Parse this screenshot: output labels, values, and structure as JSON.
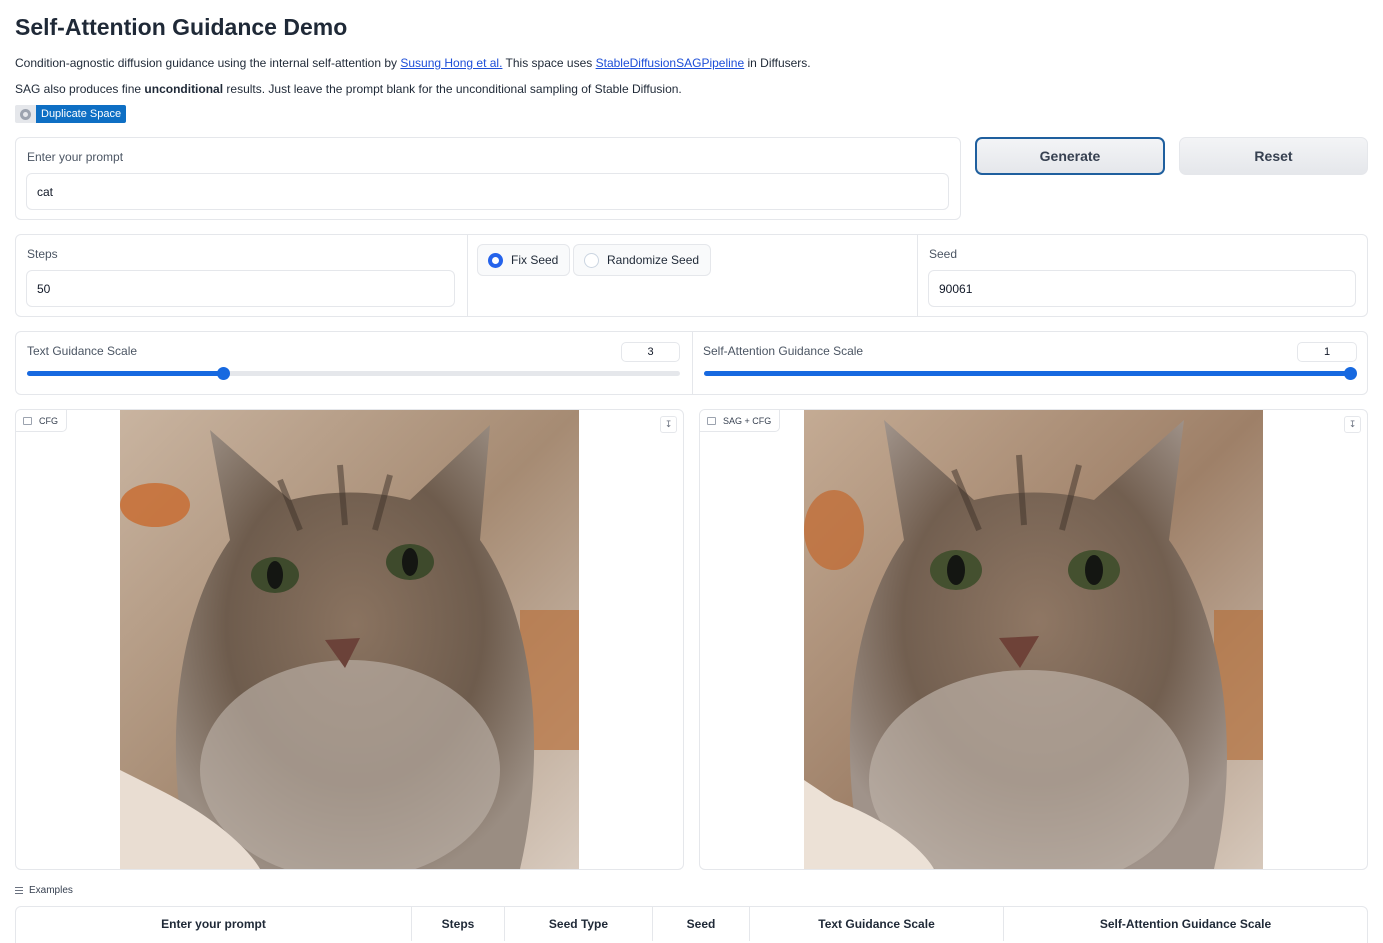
{
  "page": {
    "title": "Self-Attention Guidance Demo",
    "desc1_a": "Condition-agnostic diffusion guidance using the internal self-attention by ",
    "desc1_link1": "Susung Hong et al.",
    "desc1_b": " This space uses ",
    "desc1_link2": "StableDiffusionSAGPipeline",
    "desc1_c": " in Diffusers.",
    "desc2_a": "SAG also produces fine ",
    "desc2_bold": "unconditional",
    "desc2_b": " results. Just leave the prompt blank for the unconditional sampling of Stable Diffusion.",
    "duplicate_label": "Duplicate Space"
  },
  "prompt": {
    "label": "Enter your prompt",
    "value": "cat"
  },
  "buttons": {
    "generate": "Generate",
    "reset": "Reset"
  },
  "steps": {
    "label": "Steps",
    "value": "50"
  },
  "seed_type": {
    "options": [
      "Fix Seed",
      "Randomize Seed"
    ],
    "selected": "Fix Seed"
  },
  "seed": {
    "label": "Seed",
    "value": "90061"
  },
  "sliders": {
    "text_guidance": {
      "label": "Text Guidance Scale",
      "value": "3",
      "fraction": 0.3
    },
    "sag_guidance": {
      "label": "Self-Attention Guidance Scale",
      "value": "1",
      "fraction": 1.0
    }
  },
  "images": {
    "left_label": "CFG",
    "right_label": "SAG + CFG",
    "download_icon": "download-icon",
    "image_icon": "image-icon"
  },
  "examples": {
    "label": "Examples",
    "columns": [
      "Enter your prompt",
      "Steps",
      "Seed Type",
      "Seed",
      "Text Guidance Scale",
      "Self-Attention Guidance Scale"
    ]
  },
  "colors": {
    "accent": "#1769e0",
    "primary_border": "#1f5f9e",
    "duplicate_bg": "#0e6fc4",
    "link": "#1d4ed8"
  }
}
